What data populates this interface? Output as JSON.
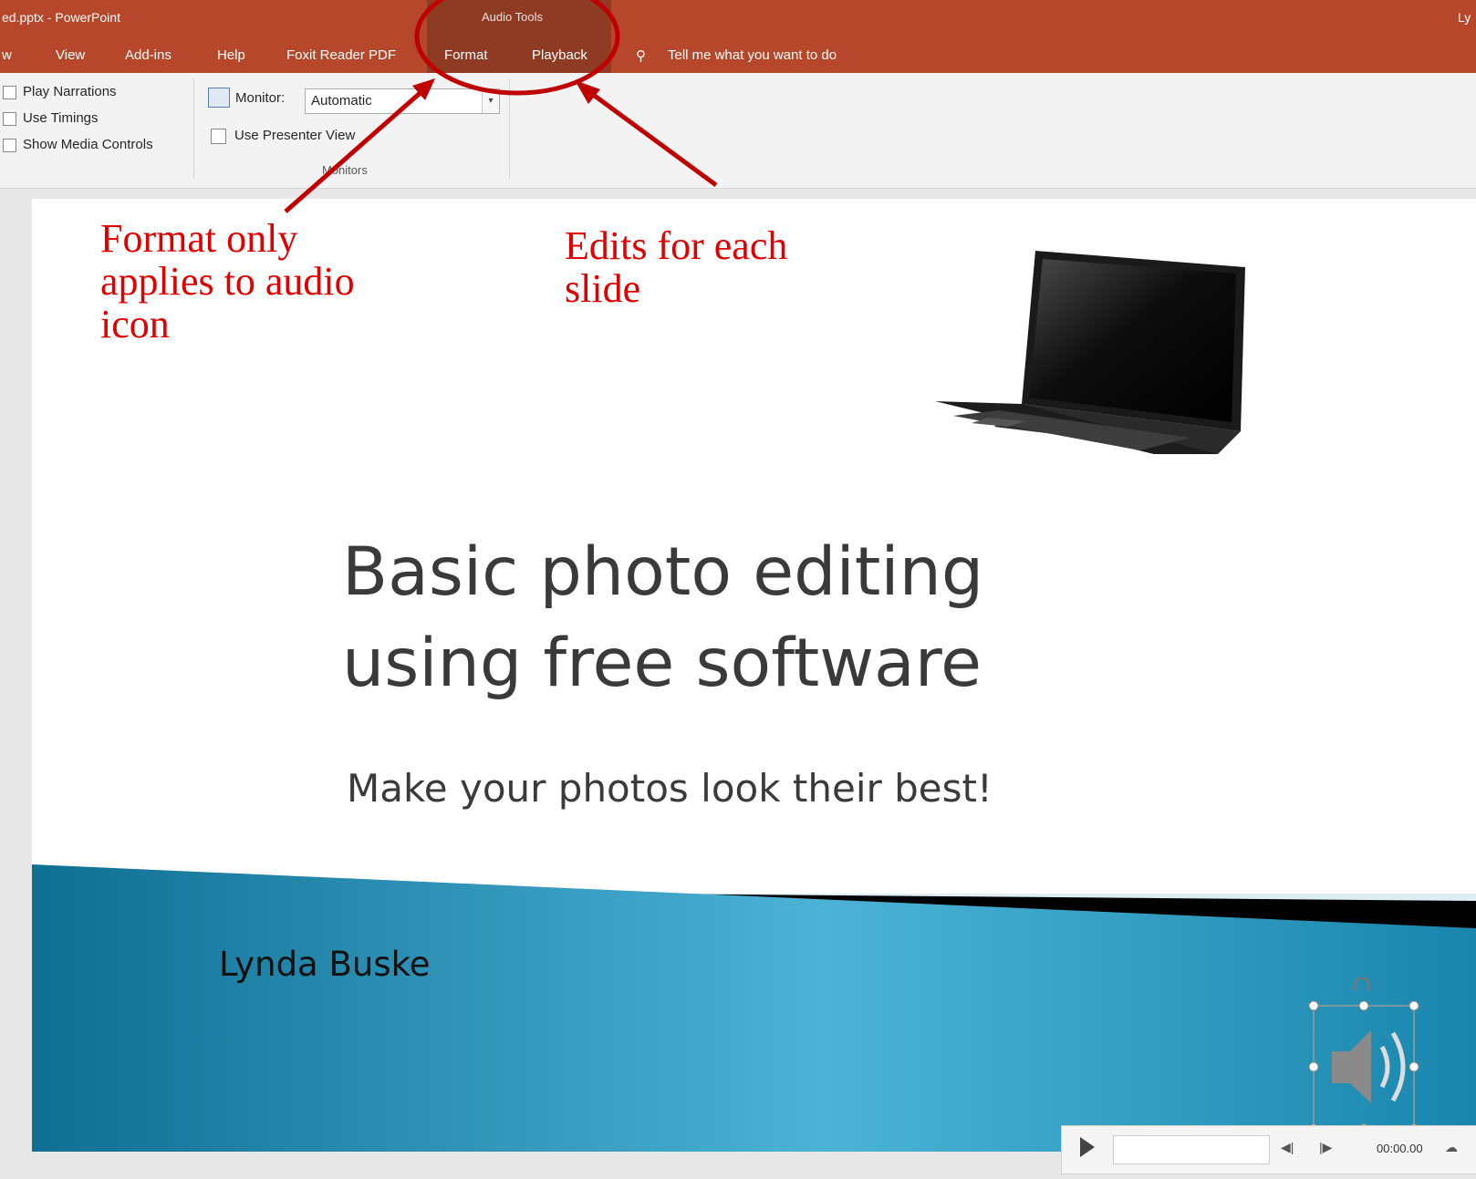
{
  "titlebar": {
    "doc_title": "ed.pptx  -  PowerPoint",
    "contextual_group": "Audio Tools",
    "user_initials": "Ly"
  },
  "tabs": [
    {
      "label": "w"
    },
    {
      "label": "View"
    },
    {
      "label": "Add-ins"
    },
    {
      "label": "Help"
    },
    {
      "label": "Foxit Reader PDF"
    },
    {
      "label": "Format"
    },
    {
      "label": "Playback"
    }
  ],
  "tell_me": "Tell me what you want to do",
  "ribbon": {
    "setup": [
      "Play Narrations",
      "Use Timings",
      "Show Media Controls"
    ],
    "monitor_label": "Monitor:",
    "monitor_value": "Automatic",
    "presenter_view": "Use Presenter View",
    "monitors_group": "Monitors"
  },
  "annotations": [
    "Format only\napplies to audio\nicon",
    "Edits for each\nslide"
  ],
  "slide": {
    "title": "Basic photo editing\nusing free software",
    "subtitle": "Make your photos look their best!",
    "author": "Lynda Buske"
  },
  "media": {
    "time": "00:00.00"
  },
  "colors": {
    "ribbon_accent": "#b7472a",
    "annotation": "#e00000",
    "slide_band": "#1b8ab0"
  }
}
